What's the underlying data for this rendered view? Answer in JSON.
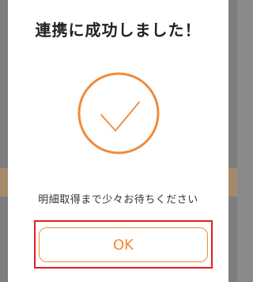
{
  "dialog": {
    "title": "連携に成功しました！",
    "message": "明細取得まで少々お待ちください",
    "ok_label": "OK"
  },
  "icons": {
    "success": "check-circle-icon"
  },
  "colors": {
    "accent": "#f08a3a",
    "highlight": "#e02020",
    "text": "#222222"
  }
}
